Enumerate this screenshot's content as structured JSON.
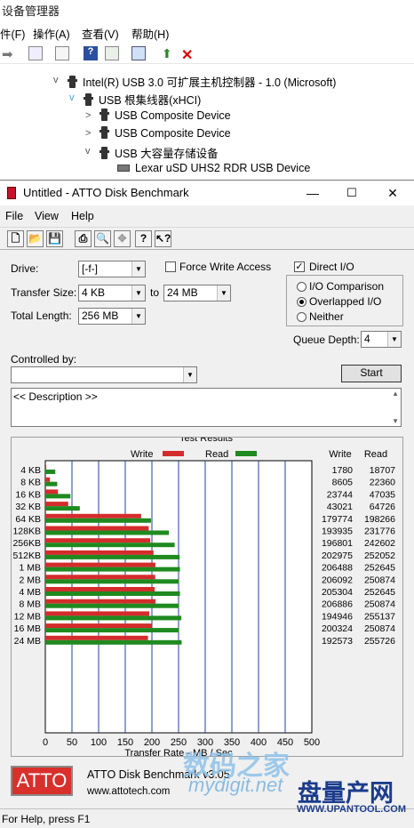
{
  "device_manager": {
    "title": "设备管理器",
    "menu": [
      "件(F)",
      "操作(A)",
      "查看(V)",
      "帮助(H)"
    ],
    "tree": [
      {
        "label": "Intel(R) USB 3.0 可扩展主机控制器 - 1.0 (Microsoft)",
        "expand": "v"
      },
      {
        "label": "USB 根集线器(xHCI)",
        "expand": "v"
      },
      {
        "label": "USB Composite Device",
        "expand": ">"
      },
      {
        "label": "USB Composite Device",
        "expand": ">"
      },
      {
        "label": "USB 大容量存储设备",
        "expand": "v"
      },
      {
        "label": "Lexar uSD UHS2 RDR USB Device",
        "expand": ""
      }
    ]
  },
  "atto": {
    "title": "Untitled - ATTO Disk Benchmark",
    "menu": [
      "File",
      "View",
      "Help"
    ],
    "drive_label": "Drive:",
    "drive_value": "[-f-]",
    "force_write_label": "Force Write Access",
    "direct_io_label": "Direct I/O",
    "direct_io_checked": true,
    "transfer_size_label": "Transfer Size:",
    "transfer_from": "4 KB",
    "to_label": "to",
    "transfer_to": "24 MB",
    "total_length_label": "Total Length:",
    "total_length": "256 MB",
    "io_comparison_label": "I/O Comparison",
    "overlapped_label": "Overlapped I/O",
    "neither_label": "Neither",
    "queue_depth_label": "Queue Depth:",
    "queue_depth": "4",
    "controlled_by_label": "Controlled by:",
    "controlled_by_value": "",
    "start_label": "Start",
    "description": "<< Description >>",
    "results_title": "Test Results",
    "legend_write": "Write",
    "legend_read": "Read",
    "col_write": "Write",
    "col_read": "Read",
    "footer_logo": "ATTO",
    "footer_app": "ATTO Disk Benchmark v3.05",
    "footer_url": "www.attotech.com",
    "status": "For Help, press F1"
  },
  "colors": {
    "write": "#d42c2c",
    "read": "#1f8a1f"
  },
  "chart_data": {
    "type": "bar",
    "orientation": "horizontal",
    "categories": [
      "4 KB",
      "8 KB",
      "16 KB",
      "32 KB",
      "64 KB",
      "128KB",
      "256KB",
      "512KB",
      "1 MB",
      "2 MB",
      "4 MB",
      "8 MB",
      "12 MB",
      "16 MB",
      "24 MB"
    ],
    "series": [
      {
        "name": "Write",
        "values": [
          1780,
          8605,
          23744,
          43021,
          179774,
          193935,
          196801,
          202975,
          206488,
          206092,
          205304,
          206886,
          194946,
          200324,
          192573
        ]
      },
      {
        "name": "Read",
        "values": [
          18707,
          22360,
          47035,
          64726,
          198266,
          231776,
          242602,
          252052,
          252645,
          250874,
          252645,
          250874,
          255137,
          250874,
          255726
        ]
      }
    ],
    "xticks": [
      0,
      50,
      100,
      150,
      200,
      250,
      300,
      350,
      400,
      450,
      500
    ],
    "xlabel": "Transfer Rate - MB / Sec",
    "xlim": [
      0,
      500
    ],
    "grid": true,
    "legend": "top"
  },
  "watermarks": {
    "site1": "数码之家",
    "site1_url": "mydigit.net",
    "site2": "盘量产网",
    "site2_url": "WWW.UPANTOOL.COM"
  }
}
